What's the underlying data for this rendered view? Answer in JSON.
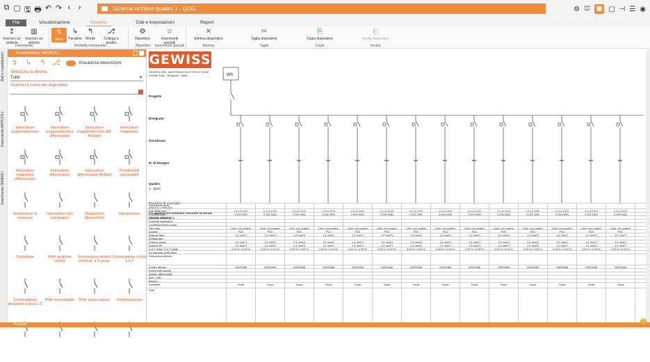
{
  "window": {
    "doc_tab_label": "Schema unifilare quadro 1 - QOG"
  },
  "quick_access": [
    "⧉",
    "▢",
    "🖫",
    "🖶",
    "↶",
    "↷",
    "‹",
    "›"
  ],
  "tabs": [
    {
      "label": "File"
    },
    {
      "label": "Visualizzazione"
    },
    {
      "label": "Disegno"
    },
    {
      "label": "Dati e impostazioni"
    },
    {
      "label": "Report"
    }
  ],
  "ribbon": {
    "buttons": [
      {
        "label": "Inserisci un simbolo",
        "icon": "↥"
      },
      {
        "label": "Inserisci un articolo",
        "icon": "▥"
      },
      {
        "label": "Serie",
        "icon": "↯"
      },
      {
        "label": "Parallelo",
        "icon": "↳"
      },
      {
        "label": "Monte",
        "icon": "↰"
      },
      {
        "label": "Collega a quadro",
        "icon": "⎇"
      },
      {
        "label": "Ripartitori",
        "icon": "⚙"
      },
      {
        "label": "Inserimenti speciali",
        "icon": "☆"
      },
      {
        "label": "Elimina dispositivo",
        "icon": "✕"
      },
      {
        "label": "Taglia dispositivo",
        "icon": "✂"
      },
      {
        "label": "Copia dispositivo",
        "icon": "⎘"
      },
      {
        "label": "Incolla dispositivo",
        "icon": "⎗"
      }
    ],
    "groups": [
      "Inserimento",
      "Modalità inserimento",
      "Ripartitori",
      "Inserimenti speciali",
      "Elimina",
      "Taglia",
      "Copia",
      "Incolla"
    ]
  },
  "side_strip": [
    "Dati e impostazioni",
    "Inserimento ARTICOLI",
    "Inserimento SIMBOLI"
  ],
  "panel": {
    "title": "Inserimento SIMBOLI",
    "toggle_label": "Visualizza descrizioni",
    "library_label": "Seleziona la libreria",
    "library_value": "Tutte",
    "search_placeholder": "Inserisci il nome del dispositivo",
    "symbols": [
      "Interruttore magnetotermico",
      "Interruttore magnetotermico differenziale",
      "Interruttore magnetotermico diff. ReStart",
      "Interruttore magnetico",
      "Interruttore magnetico differenziale",
      "Interruttore differenziale",
      "Interruttore differenziale ReStart",
      "Portafusibili sezionabile",
      "Sezionatore di manovra",
      "Interruttore non automatico",
      "Disgiuntore (Bioconfort)",
      "Salvamotore",
      "Contattore",
      "Relè gestione carichi",
      "Sezionatore rotativo commut. a 3 posiz.",
      "Commutatore a leva 1-0-2",
      "Commutatore deviatore a leva 1-2",
      "Relè monostabile",
      "Relè passo-passo",
      "Temporizzatore",
      "",
      "",
      "",
      ""
    ]
  },
  "canvas": {
    "logo": "GEWISS",
    "company": "GEWISS SPA - MATERIALE ELETTRICO 24069 Cenate Sotto - Bergamo - Italia",
    "labels": {
      "progetto": "Progetto",
      "disegnato": "Disegnato",
      "coordinato": "Coordinato",
      "n_disegno": "N° di Disegno",
      "quadro": "Quadro",
      "quadro_val": "1 - QOG",
      "tensione": "Tensione di esercizio",
      "tensione_val": "400 (V) / 230 (V)",
      "pi": "P.I. apparecchi modulari secondo la norma",
      "pi_val": "CEI EN 60947-2"
    },
    "meter": "Wh",
    "table_rows": [
      "Descrizione linea",
      "Fasi della linea",
      "Potenza totale",
      "Corrente di impiego Ib",
      "Corrente nominale In",
      "Lunghezza linea o cavo",
      "Tipo cavo",
      "Isolante",
      "Sezione fase",
      "Portata fase",
      "Sezione neutro",
      "Sezione PE",
      "C.d.T. linea / C.d.T. totale",
      "Icc massima inizio linea",
      "Descrizione articolo",
      "Codice articolo",
      "Potere interruzione",
      "Modulo differenziale",
      "Id/R / TdR",
      "Backup",
      "Selettività",
      "Note"
    ],
    "col_values": {
      "fasi": "L1 L2 L3 N",
      "potenza": "0,000 (kW)",
      "cavo": "Unip. con guaine",
      "isolante": "PVC",
      "sezione": "1,5 (mm²)",
      "cdt": "0,00 % / 0,00 %",
      "codice": "GW93488",
      "selettivita": "Totale"
    }
  },
  "status_text": "Progetto"
}
